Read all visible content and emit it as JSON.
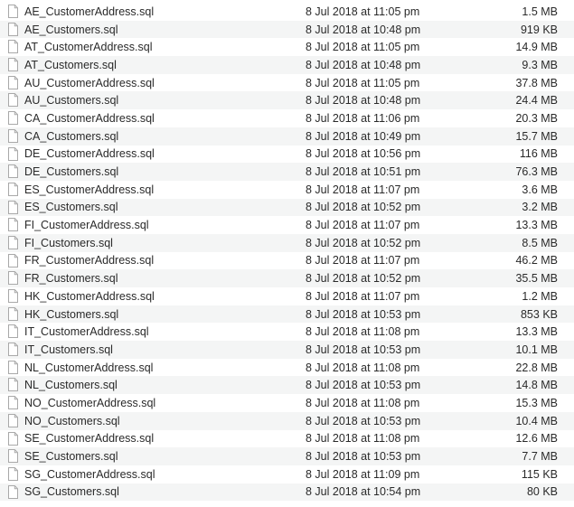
{
  "file_list": {
    "icon": "document-icon",
    "rows": [
      {
        "name": "AE_CustomerAddress.sql",
        "date": "8 Jul 2018 at 11:05 pm",
        "size": "1.5 MB"
      },
      {
        "name": "AE_Customers.sql",
        "date": "8 Jul 2018 at 10:48 pm",
        "size": "919 KB"
      },
      {
        "name": "AT_CustomerAddress.sql",
        "date": "8 Jul 2018 at 11:05 pm",
        "size": "14.9 MB"
      },
      {
        "name": "AT_Customers.sql",
        "date": "8 Jul 2018 at 10:48 pm",
        "size": "9.3 MB"
      },
      {
        "name": "AU_CustomerAddress.sql",
        "date": "8 Jul 2018 at 11:05 pm",
        "size": "37.8 MB"
      },
      {
        "name": "AU_Customers.sql",
        "date": "8 Jul 2018 at 10:48 pm",
        "size": "24.4 MB"
      },
      {
        "name": "CA_CustomerAddress.sql",
        "date": "8 Jul 2018 at 11:06 pm",
        "size": "20.3 MB"
      },
      {
        "name": "CA_Customers.sql",
        "date": "8 Jul 2018 at 10:49 pm",
        "size": "15.7 MB"
      },
      {
        "name": "DE_CustomerAddress.sql",
        "date": "8 Jul 2018 at 10:56 pm",
        "size": "116 MB"
      },
      {
        "name": "DE_Customers.sql",
        "date": "8 Jul 2018 at 10:51 pm",
        "size": "76.3 MB"
      },
      {
        "name": "ES_CustomerAddress.sql",
        "date": "8 Jul 2018 at 11:07 pm",
        "size": "3.6 MB"
      },
      {
        "name": "ES_Customers.sql",
        "date": "8 Jul 2018 at 10:52 pm",
        "size": "3.2 MB"
      },
      {
        "name": "FI_CustomerAddress.sql",
        "date": "8 Jul 2018 at 11:07 pm",
        "size": "13.3 MB"
      },
      {
        "name": "FI_Customers.sql",
        "date": "8 Jul 2018 at 10:52 pm",
        "size": "8.5 MB"
      },
      {
        "name": "FR_CustomerAddress.sql",
        "date": "8 Jul 2018 at 11:07 pm",
        "size": "46.2 MB"
      },
      {
        "name": "FR_Customers.sql",
        "date": "8 Jul 2018 at 10:52 pm",
        "size": "35.5 MB"
      },
      {
        "name": "HK_CustomerAddress.sql",
        "date": "8 Jul 2018 at 11:07 pm",
        "size": "1.2 MB"
      },
      {
        "name": "HK_Customers.sql",
        "date": "8 Jul 2018 at 10:53 pm",
        "size": "853 KB"
      },
      {
        "name": "IT_CustomerAddress.sql",
        "date": "8 Jul 2018 at 11:08 pm",
        "size": "13.3 MB"
      },
      {
        "name": "IT_Customers.sql",
        "date": "8 Jul 2018 at 10:53 pm",
        "size": "10.1 MB"
      },
      {
        "name": "NL_CustomerAddress.sql",
        "date": "8 Jul 2018 at 11:08 pm",
        "size": "22.8 MB"
      },
      {
        "name": "NL_Customers.sql",
        "date": "8 Jul 2018 at 10:53 pm",
        "size": "14.8 MB"
      },
      {
        "name": "NO_CustomerAddress.sql",
        "date": "8 Jul 2018 at 11:08 pm",
        "size": "15.3 MB"
      },
      {
        "name": "NO_Customers.sql",
        "date": "8 Jul 2018 at 10:53 pm",
        "size": "10.4 MB"
      },
      {
        "name": "SE_CustomerAddress.sql",
        "date": "8 Jul 2018 at 11:08 pm",
        "size": "12.6 MB"
      },
      {
        "name": "SE_Customers.sql",
        "date": "8 Jul 2018 at 10:53 pm",
        "size": "7.7 MB"
      },
      {
        "name": "SG_CustomerAddress.sql",
        "date": "8 Jul 2018 at 11:09 pm",
        "size": "115 KB"
      },
      {
        "name": "SG_Customers.sql",
        "date": "8 Jul 2018 at 10:54 pm",
        "size": "80 KB"
      }
    ]
  }
}
